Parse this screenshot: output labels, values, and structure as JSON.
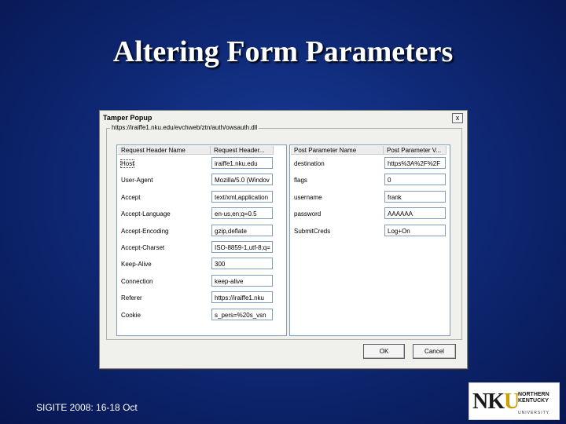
{
  "slide": {
    "title": "Altering Form Parameters",
    "footer": "SIGITE 2008: 16-18 Oct"
  },
  "logo": {
    "mark_letters": "NK",
    "mark_u": "U",
    "line1": "NORTHERN",
    "line2": "KENTUCKY",
    "line3": "UNIVERSITY"
  },
  "dialog": {
    "title": "Tamper Popup",
    "close_label": "x",
    "url": "https://iraiffe1.nku.edu/evchweb/ztn/auth/owsauth.dll",
    "headers": {
      "col_name": "Request Header Name",
      "col_value": "Request Header...",
      "rows": [
        {
          "name": "Host",
          "value": "iraiffe1.nku.edu"
        },
        {
          "name": "User-Agent",
          "value": "Mozilla/5.0 (Windov"
        },
        {
          "name": "Accept",
          "value": "text/xml,application"
        },
        {
          "name": "Accept-Language",
          "value": "en-us,en;q=0.5"
        },
        {
          "name": "Accept-Encoding",
          "value": "gzip,deflate"
        },
        {
          "name": "Accept-Charset",
          "value": "ISO-8859-1,utf-8;q="
        },
        {
          "name": "Keep-Alive",
          "value": "300"
        },
        {
          "name": "Connection",
          "value": "keep-alive"
        },
        {
          "name": "Referer",
          "value": "https://iraiffe1.nku"
        },
        {
          "name": "Cookie",
          "value": "s_pers=%20s_vsn"
        }
      ]
    },
    "params": {
      "col_name": "Post Parameter Name",
      "col_value": "Post Parameter V...",
      "rows": [
        {
          "name": "destination",
          "value": "https%3A%2F%2F"
        },
        {
          "name": "flags",
          "value": "0"
        },
        {
          "name": "username",
          "value": "frank"
        },
        {
          "name": "password",
          "value": "AAAAAA"
        },
        {
          "name": "SubmitCreds",
          "value": "Log+On"
        }
      ]
    },
    "ok_label": "OK",
    "cancel_label": "Cancel"
  }
}
